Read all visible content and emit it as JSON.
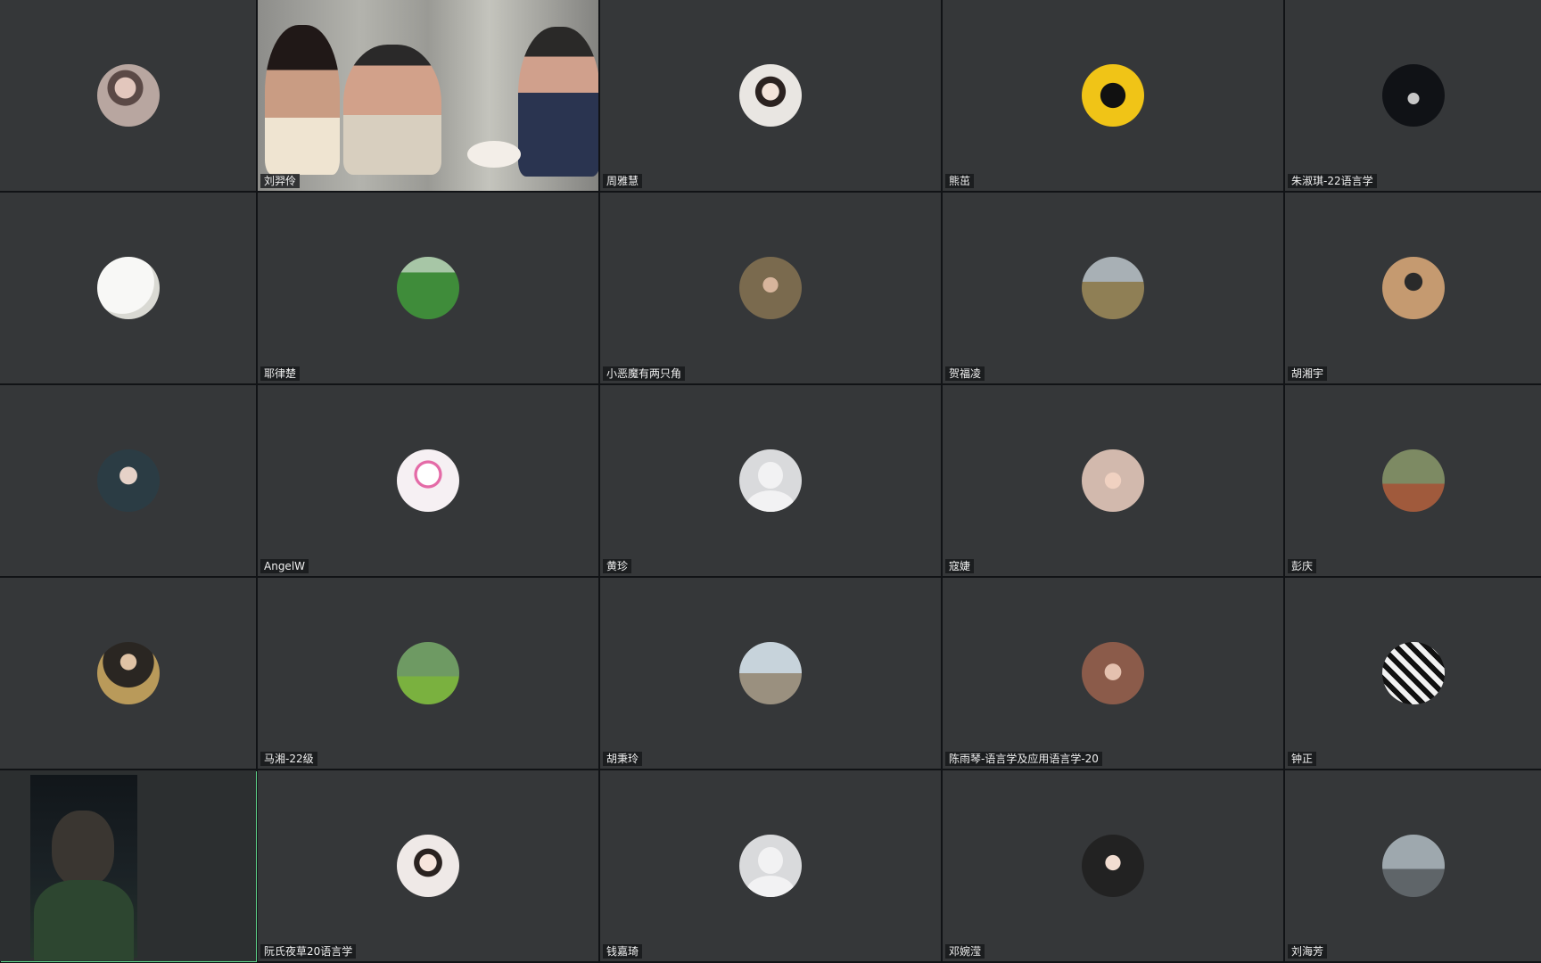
{
  "meeting": {
    "participants": [
      {
        "name": "",
        "avatar_color": "#b8a6a0",
        "avatar_kind": "photo"
      },
      {
        "name": "刘羿伶",
        "avatar_kind": "video"
      },
      {
        "name": "周雅慧",
        "avatar_color": "#e9e6e2",
        "avatar_kind": "photo"
      },
      {
        "name": "熊茁",
        "avatar_color": "#f0c417",
        "avatar_kind": "photo"
      },
      {
        "name": "朱淑琪-22语言学",
        "avatar_color": "#101216",
        "avatar_kind": "photo"
      },
      {
        "name": "",
        "avatar_color": "#f1f1ef",
        "avatar_kind": "photo"
      },
      {
        "name": "耶律楚",
        "avatar_color": "#3f8c3a",
        "avatar_kind": "photo"
      },
      {
        "name": "小恶魔有两只角",
        "avatar_color": "#6b5a3e",
        "avatar_kind": "photo"
      },
      {
        "name": "贺福凌",
        "avatar_color": "#a59e7c",
        "avatar_kind": "photo"
      },
      {
        "name": "胡湘宇",
        "avatar_color": "#c59a70",
        "avatar_kind": "photo"
      },
      {
        "name": "",
        "avatar_color": "#2b3c44",
        "avatar_kind": "photo"
      },
      {
        "name": "AngelW",
        "avatar_color": "#f6f0f3",
        "avatar_kind": "photo"
      },
      {
        "name": "黄珍",
        "avatar_kind": "placeholder"
      },
      {
        "name": "寇婕",
        "avatar_color": "#d2b9ad",
        "avatar_kind": "photo"
      },
      {
        "name": "彭庆",
        "avatar_color": "#667a53",
        "avatar_kind": "photo"
      },
      {
        "name": "",
        "avatar_color": "#b99a5a",
        "avatar_kind": "photo"
      },
      {
        "name": "马湘-22级",
        "avatar_color": "#5c8c46",
        "avatar_kind": "photo"
      },
      {
        "name": "胡秉玲",
        "avatar_color": "#b8b1a4",
        "avatar_kind": "photo"
      },
      {
        "name": "陈雨琴-语言学及应用语言学-20",
        "avatar_color": "#8b5b4a",
        "avatar_kind": "photo"
      },
      {
        "name": "钟正",
        "avatar_color": "#e9e9e9",
        "avatar_kind": "photo"
      },
      {
        "name": "",
        "avatar_kind": "dark-video"
      },
      {
        "name": "阮氏夜草20语言学",
        "avatar_color": "#efe9e7",
        "avatar_kind": "photo"
      },
      {
        "name": "钱嘉琦",
        "avatar_kind": "placeholder"
      },
      {
        "name": "邓婉滢",
        "avatar_color": "#222222",
        "avatar_kind": "photo"
      },
      {
        "name": "刘海芳",
        "avatar_color": "#8a9aa3",
        "avatar_kind": "photo"
      }
    ]
  },
  "colors": {
    "tile_bg": "#353739",
    "gap": "#111316",
    "active_speaker_border": "#5fd38a",
    "label_text": "#f0f0f0"
  }
}
